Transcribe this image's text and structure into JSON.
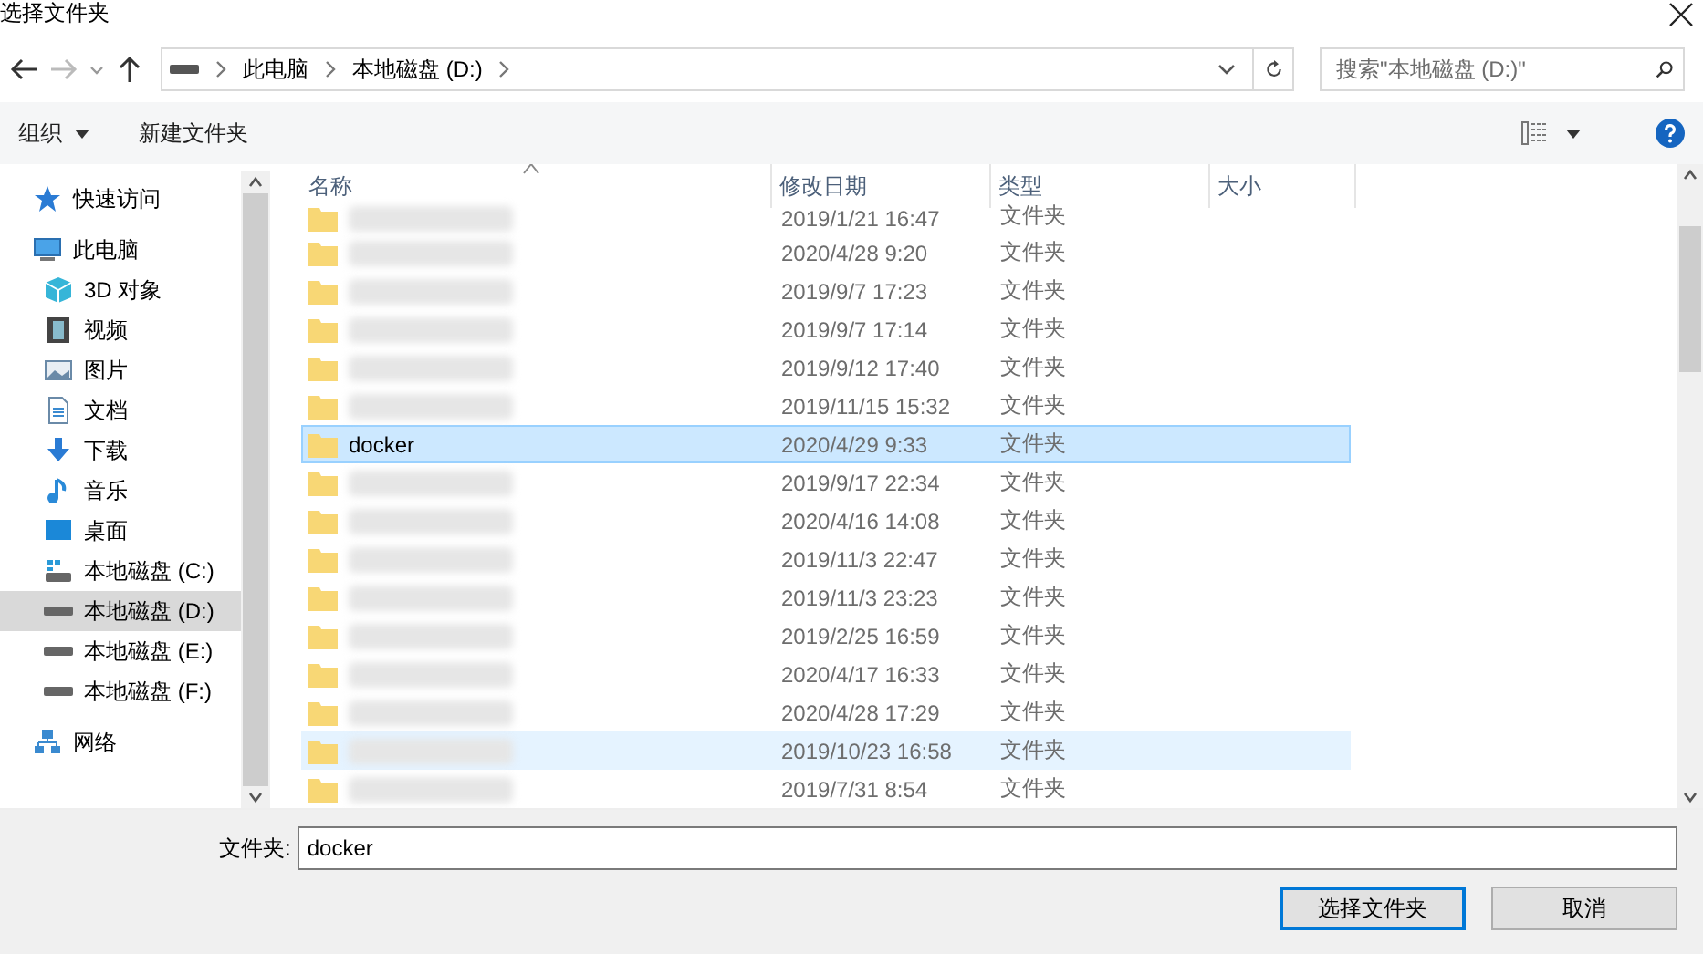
{
  "window": {
    "title": "选择文件夹"
  },
  "nav": {
    "breadcrumbs": [
      "此电脑",
      "本地磁盘 (D:)"
    ],
    "search": {
      "placeholder": "搜索\"本地磁盘 (D:)\""
    }
  },
  "toolbar": {
    "organize": "组织",
    "new_folder": "新建文件夹"
  },
  "sidebar": {
    "items": [
      {
        "label": "快速访问",
        "kind": "star",
        "selected": false
      },
      {
        "label": "此电脑",
        "kind": "pc",
        "selected": false,
        "children": [
          {
            "label": "3D 对象",
            "kind": "cube",
            "selected": false
          },
          {
            "label": "视频",
            "kind": "video",
            "selected": false
          },
          {
            "label": "图片",
            "kind": "image",
            "selected": false
          },
          {
            "label": "文档",
            "kind": "doc",
            "selected": false
          },
          {
            "label": "下载",
            "kind": "download",
            "selected": false
          },
          {
            "label": "音乐",
            "kind": "music",
            "selected": false
          },
          {
            "label": "桌面",
            "kind": "desktop",
            "selected": false
          },
          {
            "label": "本地磁盘 (C:)",
            "kind": "sysdrive",
            "selected": false
          },
          {
            "label": "本地磁盘 (D:)",
            "kind": "drive",
            "selected": true
          },
          {
            "label": "本地磁盘 (E:)",
            "kind": "drive",
            "selected": false
          },
          {
            "label": "本地磁盘 (F:)",
            "kind": "drive",
            "selected": false
          }
        ]
      },
      {
        "label": "网络",
        "kind": "network",
        "selected": false
      }
    ]
  },
  "table": {
    "columns": [
      "名称",
      "修改日期",
      "类型",
      "大小"
    ],
    "rows": [
      {
        "modified": "2019/1/21 16:47",
        "type": "文件夹",
        "selected": false,
        "hovered": false
      },
      {
        "modified": "2020/4/28 9:20",
        "type": "文件夹",
        "selected": false,
        "hovered": false
      },
      {
        "modified": "2019/9/7 17:23",
        "type": "文件夹",
        "selected": false,
        "hovered": false
      },
      {
        "modified": "2019/9/7 17:14",
        "type": "文件夹",
        "selected": false,
        "hovered": false
      },
      {
        "modified": "2019/9/12 17:40",
        "type": "文件夹",
        "selected": false,
        "hovered": false
      },
      {
        "modified": "2019/11/15 15:32",
        "type": "文件夹",
        "selected": false,
        "hovered": false
      },
      {
        "name": "docker",
        "modified": "2020/4/29 9:33",
        "type": "文件夹",
        "selected": true,
        "hovered": false
      },
      {
        "modified": "2019/9/17 22:34",
        "type": "文件夹",
        "selected": false,
        "hovered": false
      },
      {
        "modified": "2020/4/16 14:08",
        "type": "文件夹",
        "selected": false,
        "hovered": false
      },
      {
        "modified": "2019/11/3 22:47",
        "type": "文件夹",
        "selected": false,
        "hovered": false
      },
      {
        "modified": "2019/11/3 23:23",
        "type": "文件夹",
        "selected": false,
        "hovered": false
      },
      {
        "modified": "2019/2/25 16:59",
        "type": "文件夹",
        "selected": false,
        "hovered": false
      },
      {
        "modified": "2020/4/17 16:33",
        "type": "文件夹",
        "selected": false,
        "hovered": false
      },
      {
        "modified": "2020/4/28 17:29",
        "type": "文件夹",
        "selected": false,
        "hovered": false
      },
      {
        "modified": "2019/10/23 16:58",
        "type": "文件夹",
        "selected": false,
        "hovered": true
      },
      {
        "modified": "2019/7/31 8:54",
        "type": "文件夹",
        "selected": false,
        "hovered": false
      }
    ]
  },
  "footer": {
    "folder_label": "文件夹:",
    "folder_value": "docker",
    "buttons": [
      {
        "label": "选择文件夹",
        "kind": "primary"
      },
      {
        "label": "取消",
        "kind": "normal"
      }
    ]
  }
}
